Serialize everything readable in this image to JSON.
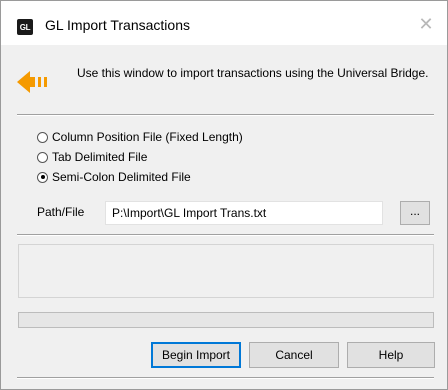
{
  "window": {
    "icon_text": "GL",
    "title": "GL Import Transactions",
    "close_glyph": "✕"
  },
  "info": {
    "icon": "arrow-left-icon",
    "text": "Use this window to import transactions using the Universal Bridge."
  },
  "file_type": {
    "options": [
      {
        "label": "Column Position File (Fixed Length)",
        "checked": false
      },
      {
        "label": "Tab Delimited File",
        "checked": false
      },
      {
        "label": "Semi-Colon Delimited File",
        "checked": true
      }
    ]
  },
  "path": {
    "label": "Path/File",
    "value": "P:\\Import\\GL Import Trans.txt",
    "browse_label": "..."
  },
  "progress": {
    "value": 0
  },
  "buttons": {
    "begin_import": "Begin Import",
    "cancel": "Cancel",
    "help": "Help"
  },
  "colors": {
    "accent": "#0078d7",
    "arrow": "#f59a00",
    "progress": "#06b025"
  }
}
